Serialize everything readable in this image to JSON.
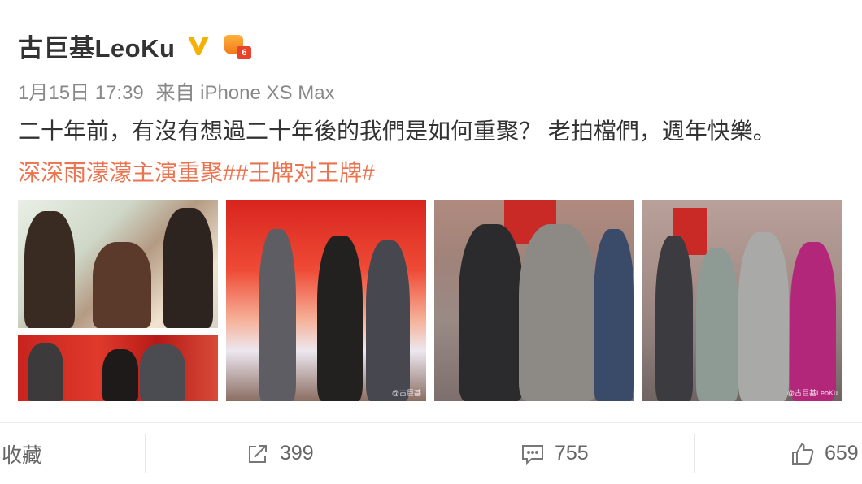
{
  "author": {
    "name": "古巨基LeoKu",
    "level": "6"
  },
  "meta": {
    "date": "1月15日 17:39",
    "source": "来自 iPhone XS Max"
  },
  "post": {
    "text": "二十年前，有沒有想過二十年後的我們是如何重聚？ 老拍檔們，週年快樂。",
    "tags": "深深雨濛濛主演重聚##王牌对王牌#"
  },
  "photos": [
    {
      "name": "photo-1"
    },
    {
      "name": "photo-2",
      "watermark": "@古巨基"
    },
    {
      "name": "photo-3"
    },
    {
      "name": "photo-4",
      "watermark": "@古巨基LeoKu"
    }
  ],
  "actions": {
    "favorite_label": "收藏",
    "repost_count": "399",
    "comment_count": "755",
    "like_count": "659"
  },
  "colors": {
    "tag": "#eb7350",
    "verified": "#f5b000",
    "meta": "#888888"
  }
}
